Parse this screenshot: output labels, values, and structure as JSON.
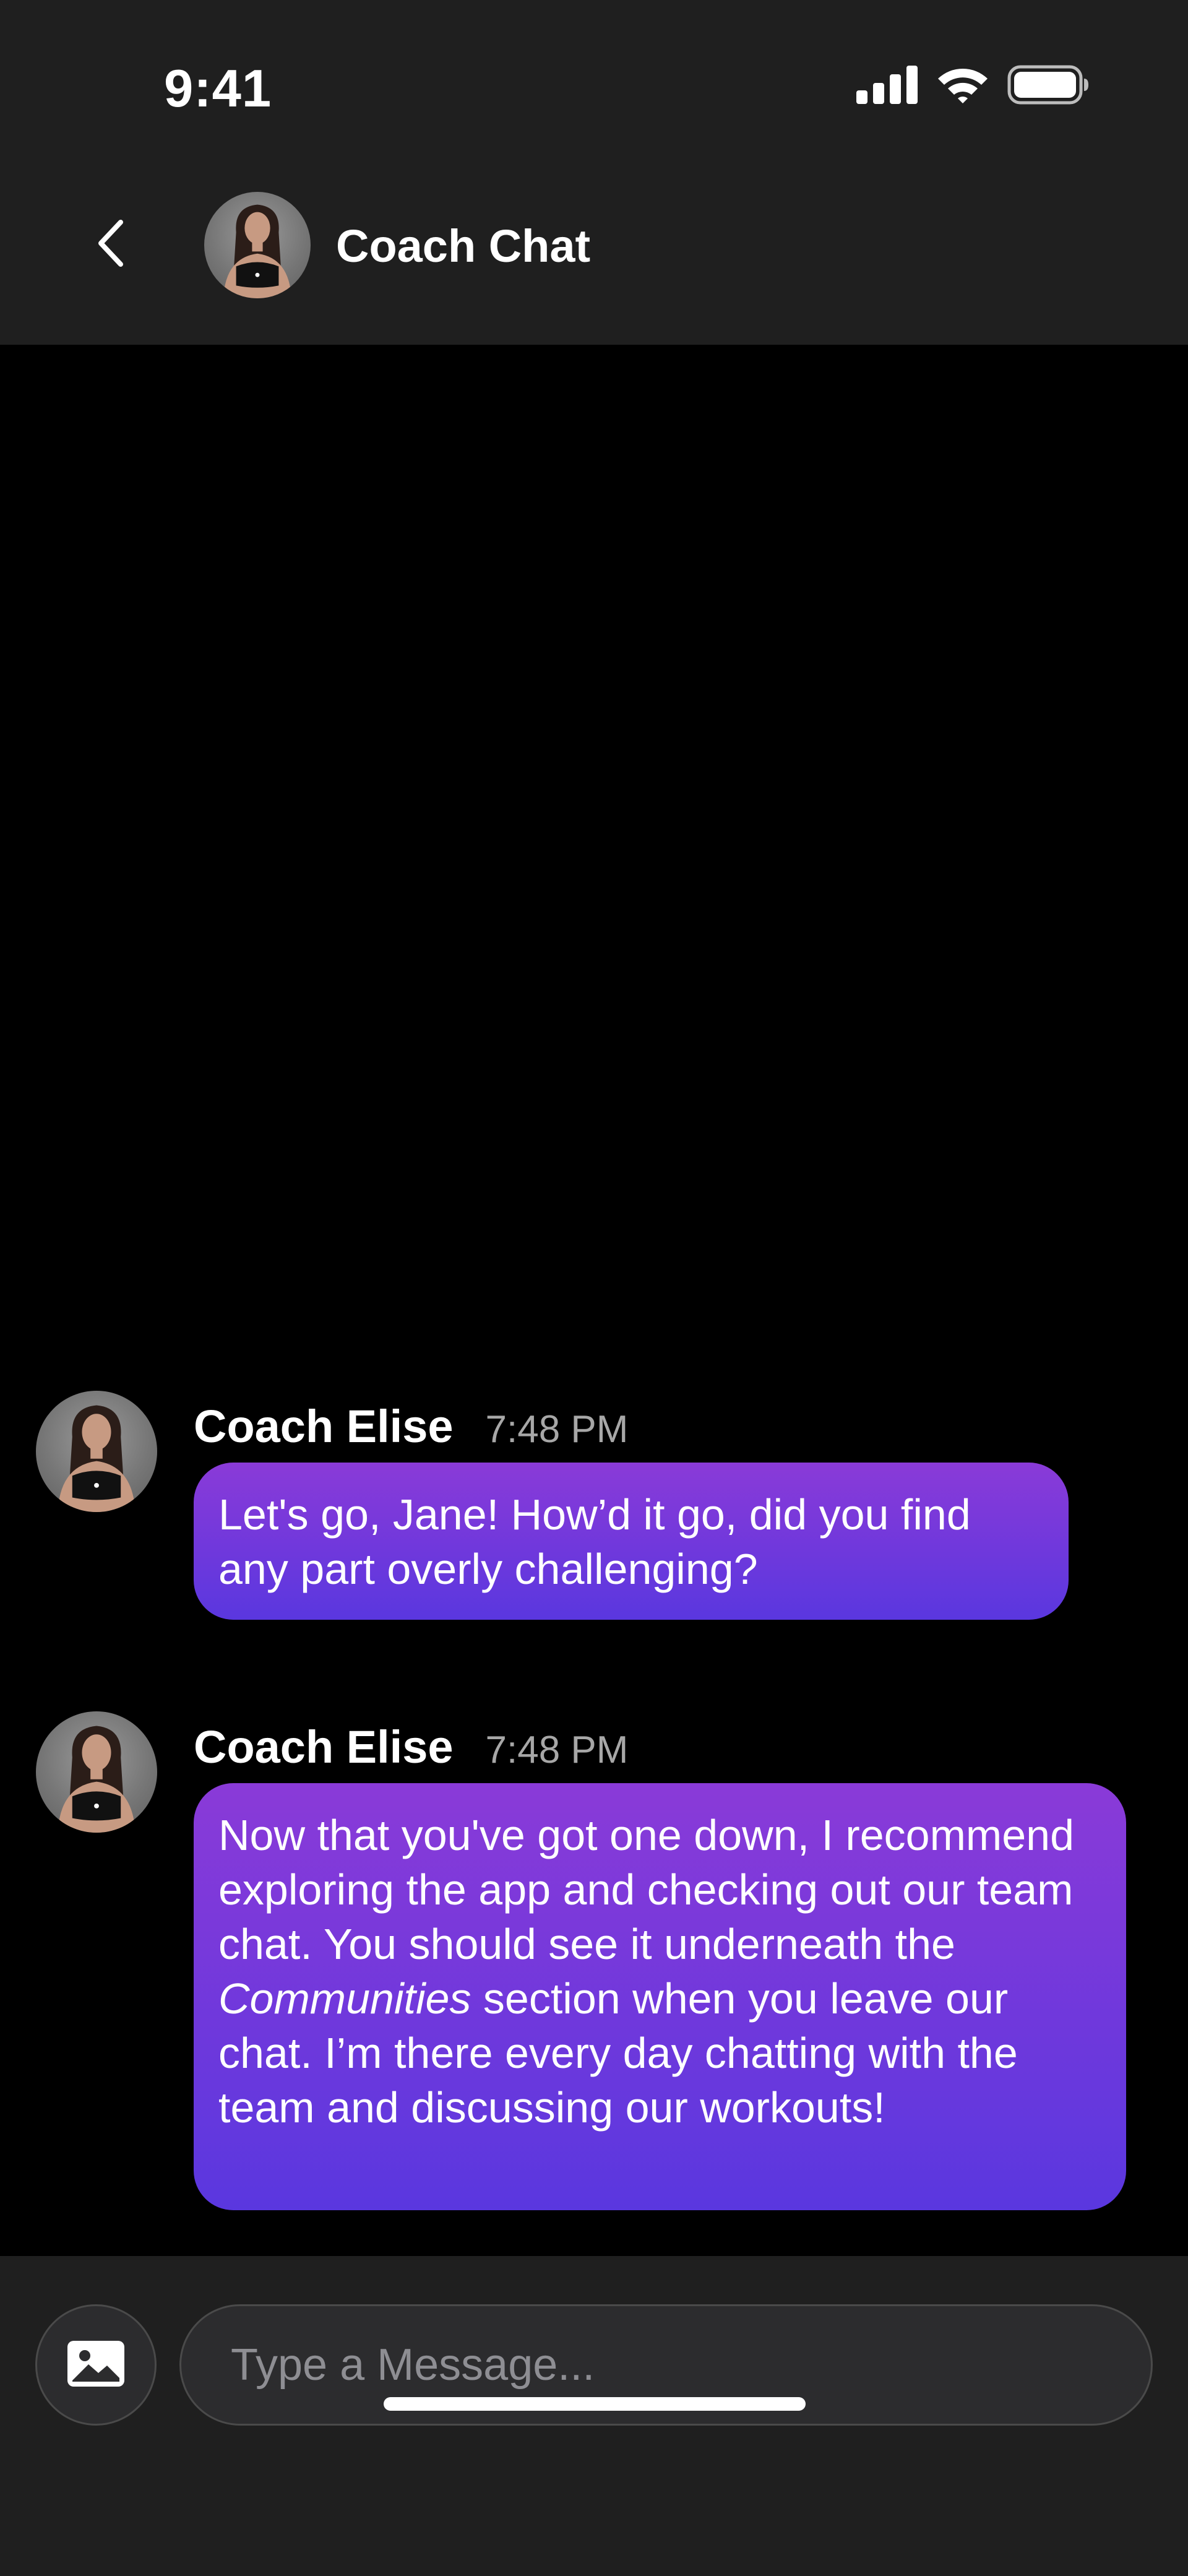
{
  "status_bar": {
    "time": "9:41",
    "signal_icon": "cellular-signal-icon",
    "wifi_icon": "wifi-icon",
    "battery_icon": "battery-icon"
  },
  "header": {
    "back_icon": "chevron-left-icon",
    "title": "Coach Chat"
  },
  "messages": [
    {
      "sender": "Coach Elise",
      "time": "7:48 PM",
      "text": "Let's go, Jane! How’d it go, did you find any part overly challenging?"
    },
    {
      "sender": "Coach Elise",
      "time": "7:48 PM",
      "text_before": "Now that you've got one down, I recommend exploring the app and checking out our team chat. You should see it underneath the ",
      "text_emphasis": "Communities",
      "text_after": " section when you leave our chat. I’m there every day chatting with the team and discussing our workouts!"
    }
  ],
  "composer": {
    "image_icon": "image-icon",
    "placeholder": "Type a Message...",
    "value": ""
  },
  "colors": {
    "background": "#000000",
    "bar_background": "#1f1f1f",
    "bubble_gradient_top": "#8a3ad8",
    "bubble_gradient_bottom": "#5a37df",
    "timestamp": "#a7a7a7"
  }
}
